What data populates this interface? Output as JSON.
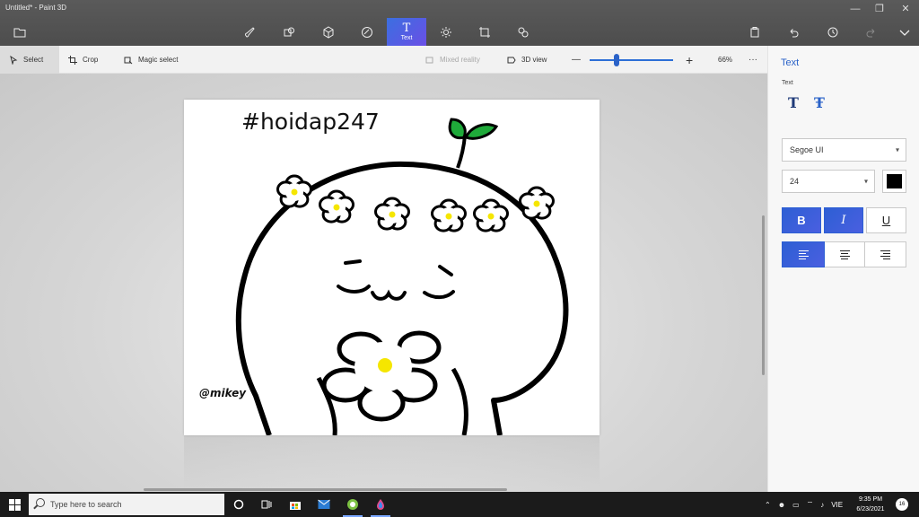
{
  "window": {
    "title": "Untitled* - Paint 3D"
  },
  "toolbar": {
    "tools": [
      "menu",
      "brushes",
      "2d-shapes",
      "3d-shapes",
      "stickers",
      "text",
      "effects",
      "canvas",
      "3d-library"
    ],
    "active_tool_label": "Text",
    "active_tool_glyph": "T"
  },
  "subbar": {
    "select_label": "Select",
    "crop_label": "Crop",
    "magic_select_label": "Magic select",
    "mixed_reality_label": "Mixed reality",
    "view_3d_label": "3D view",
    "zoom_minus": "—",
    "zoom_plus": "+",
    "zoom_level": "66%",
    "zoom_fraction": 0.32,
    "more": "···"
  },
  "canvas": {
    "heading": "#hoidap247",
    "signature": "@mikey"
  },
  "panel": {
    "title": "Text",
    "section_label": "Text",
    "font_family_value": "Segoe UI",
    "font_size_value": "24",
    "color": "#000000",
    "bold_label": "B",
    "italic_label": "I",
    "underline_label": "U",
    "bold_on": true,
    "italic_on": true,
    "underline_on": false,
    "align": "left"
  },
  "taskbar": {
    "search_placeholder": "Type here to search",
    "language": "VIE",
    "time": "9:35 PM",
    "date": "6/23/2021",
    "notification_count": "16"
  },
  "colors": {
    "accent": "#2d62d2",
    "leaf_green": "#1faa3a",
    "flower_center": "#f5e600"
  }
}
